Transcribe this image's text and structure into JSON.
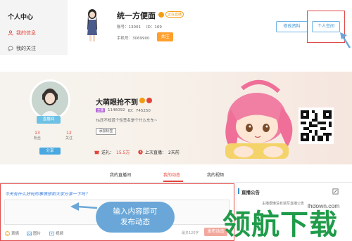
{
  "sidebar": {
    "title": "个人中心",
    "items": [
      {
        "label": "我的信息",
        "icon": "user-icon"
      },
      {
        "label": "我的关注",
        "icon": "chat-icon"
      }
    ]
  },
  "header_profile": {
    "name": "统一方便面",
    "tag": "正在直播",
    "account_label": "账号：",
    "account": "13001",
    "id_label": "ID：",
    "id": "169",
    "phone_label": "手机号：",
    "phone": "3069900",
    "attend_button": "关注",
    "edit_button": "修改资料",
    "space_button": "个人空间"
  },
  "banner": {
    "name": "大萌眼抢不到",
    "badge": "主播",
    "number": "1146092",
    "id_label": "ID：",
    "id": "745250",
    "bio": "Ta还不知道个性签名是个什么东东~",
    "tag_button": "添加标签",
    "live_button": "直播间",
    "fans_count": "13",
    "fans_label": "粉丝",
    "follow_count": "12",
    "follow_label": "关注",
    "share_button": "分享",
    "gift_label": "送礼：",
    "gift_value": "15.5万",
    "last_live_label": "上次直播：",
    "last_live_value": "2天前"
  },
  "tabs": [
    "我的直播间",
    "我的动态",
    "我的视频"
  ],
  "active_tab": 1,
  "post": {
    "prompt": "今天有什么好玩的事情想和大家分享一下吗？",
    "tools": [
      "表情",
      "图片",
      "视频"
    ],
    "counter": "最多120字",
    "publish_button": "发布动态"
  },
  "callout": {
    "line1": "输入内容即可",
    "line2": "发布动态"
  },
  "notice": {
    "title": "直播公告",
    "body": "主播很懒没有填写直播公告"
  },
  "watermark": {
    "url": "lhdown.com",
    "text": "领航下载"
  },
  "colors": {
    "accent_red": "#e2453b",
    "accent_blue": "#3b8fd1",
    "watermark_green": "#1f9b49"
  }
}
